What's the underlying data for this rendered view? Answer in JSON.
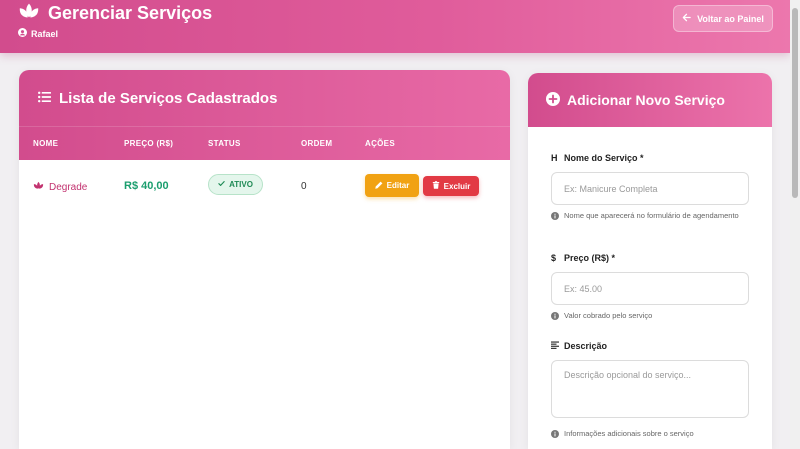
{
  "header": {
    "title": "Gerenciar Serviços",
    "user": "Rafael",
    "back_button": "Voltar ao Painel"
  },
  "services_card": {
    "title": "Lista de Serviços Cadastrados",
    "columns": [
      "NOME",
      "PREÇO (R$)",
      "STATUS",
      "ORDEM",
      "AÇÕES"
    ],
    "rows": [
      {
        "name": "Degrade",
        "price": "R$ 40,00",
        "status": "ATIVO",
        "order": "0",
        "edit_label": "Editar",
        "delete_label": "Excluir"
      }
    ]
  },
  "form_card": {
    "title": "Adicionar Novo Serviço",
    "name_field": {
      "label": "Nome do Serviço *",
      "placeholder": "Ex: Manicure Completa",
      "help": "Nome que aparecerá no formulário de agendamento"
    },
    "price_field": {
      "label": "Preço (R$) *",
      "placeholder": "Ex: 45.00",
      "help": "Valor cobrado pelo serviço"
    },
    "description_field": {
      "label": "Descrição",
      "placeholder": "Descrição opcional do serviço...",
      "help": "Informações adicionais sobre o serviço"
    }
  },
  "colors": {
    "primary": "#d24c8d",
    "price_green": "#1b9e6e",
    "edit_orange": "#f1a213",
    "delete_red": "#e23a44"
  }
}
